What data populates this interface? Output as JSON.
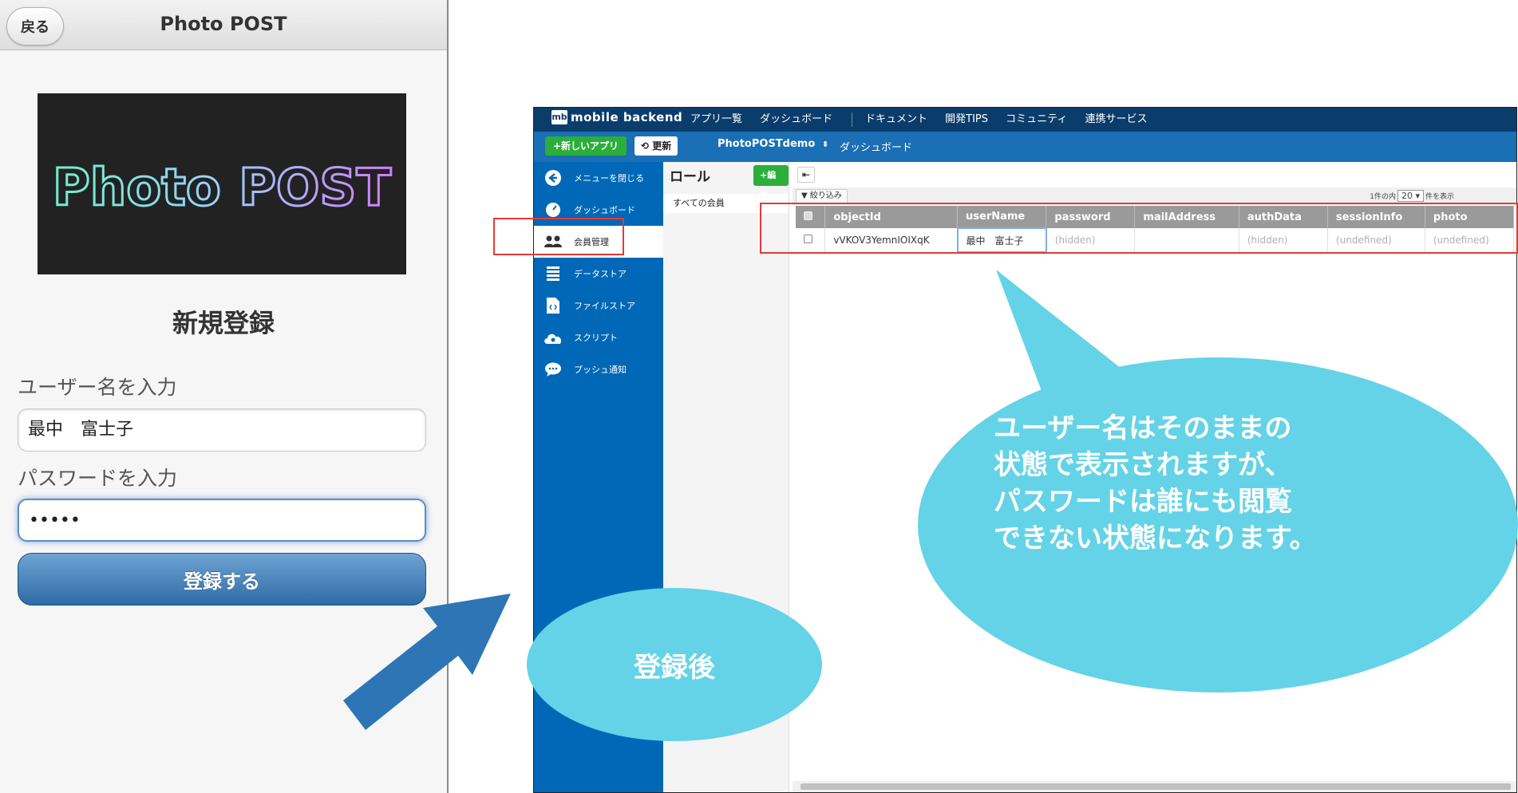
{
  "phone": {
    "back_label": "戻る",
    "title": "Photo POST",
    "logo_text": "Photo POST",
    "register_title": "新規登録",
    "username_label": "ユーザー名を入力",
    "username_value": "最中　富士子",
    "password_label": "パスワードを入力",
    "password_value": "•••••",
    "submit_label": "登録する"
  },
  "console": {
    "brand_badge": "mb",
    "brand_name": "mobile backend",
    "nav": [
      "アプリ一覧",
      "ダッシュボード",
      "ドキュメント",
      "開発TIPS",
      "コミュニティ",
      "連携サービス"
    ],
    "new_app_label": "+新しいアプリ",
    "refresh_label": "更新",
    "app_name": "PhotoPOSTdemo",
    "breadcrumb": "ダッシュボード",
    "sidebar": [
      {
        "label": "メニューを閉じる",
        "icon": "arrow-left-circle-icon"
      },
      {
        "label": "ダッシュボード",
        "icon": "gauge-icon"
      },
      {
        "label": "会員管理",
        "icon": "users-icon"
      },
      {
        "label": "データストア",
        "icon": "list-icon"
      },
      {
        "label": "ファイルストア",
        "icon": "file-code-icon"
      },
      {
        "label": "スクリプト",
        "icon": "cloud-gear-icon"
      },
      {
        "label": "プッシュ通知",
        "icon": "chat-bubble-icon"
      }
    ],
    "role_title": "ロール",
    "edit_label": "+編集",
    "all_members": "すべての会員",
    "filter_label": "絞り込み",
    "paging_prefix": "1件の内",
    "paging_value": "20",
    "paging_suffix": "件を表示",
    "columns": [
      "objectId",
      "userName",
      "password",
      "mailAddress",
      "authData",
      "sessionInfo",
      "photo"
    ],
    "rows": [
      [
        "vVKOV3YemnIOIXqK",
        "最中　富士子",
        "(hidden)",
        "",
        "(hidden)",
        "(undefined)",
        "(undefined)"
      ]
    ]
  },
  "callouts": {
    "big": "ユーザー名はそのままの\n状態で表示されますが、\nパスワードは誰にも閲覧\nできない状態になります。",
    "small": "登録後"
  },
  "colors": {
    "bubble": "#64d3e7",
    "arrow": "#2e75b6",
    "highlight": "#e53935",
    "console_topbar": "#0a3d6b",
    "console_sidebar": "#0068b7"
  }
}
